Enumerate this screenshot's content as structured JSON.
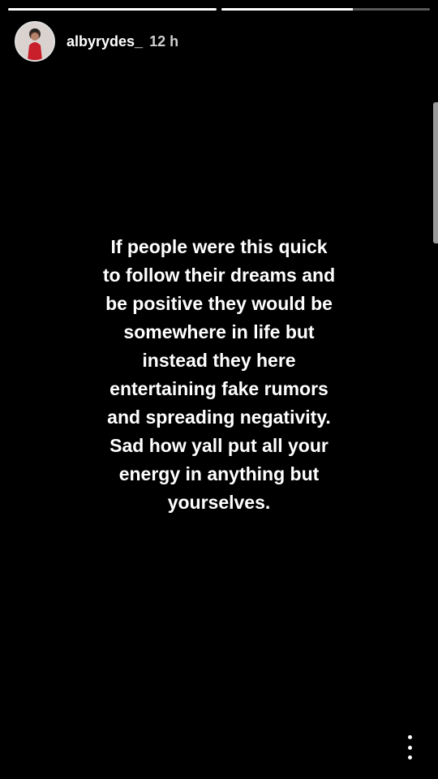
{
  "story": {
    "progress": [
      1.0,
      0.63
    ],
    "user": {
      "username": "albyrydes_",
      "timestamp": "12 h",
      "avatar_icon": "profile-avatar"
    },
    "text": "If people were this quick\nto follow their dreams and\nbe positive they would be\nsomewhere in life but\ninstead they here\nentertaining fake rumors\nand spreading negativity.\nSad how yall put all your\nenergy in anything but\nyourselves.",
    "more_icon": "more-vertical-icon"
  },
  "colors": {
    "background": "#000000",
    "text": "#ffffff",
    "timestamp": "#cfcfcf"
  }
}
